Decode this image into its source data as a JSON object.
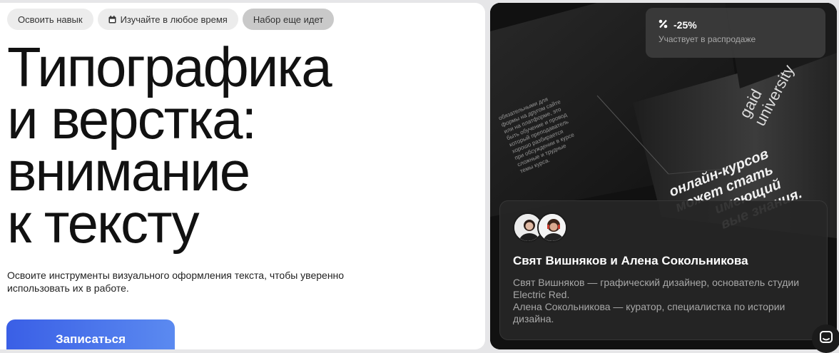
{
  "chips": [
    {
      "label": "Освоить навык"
    },
    {
      "label": "Изучайте в любое время",
      "icon": "calendar-icon"
    },
    {
      "label": "Набор еще идет"
    }
  ],
  "hero": {
    "title_lines": [
      "Типографика",
      "и верстка:",
      "внимание",
      "к тексту"
    ],
    "description_line1": "Освоите инструменты визуального оформления текста, чтобы уверенно",
    "description_line2": "использовать их в работе.",
    "cta_label": "Записаться"
  },
  "discount": {
    "icon": "percent-icon",
    "value": "-25%",
    "caption": "Участвует в распродаже"
  },
  "authors": {
    "names": "Свят Вишняков и Алена Сокольникова",
    "bio_line1": "Свят Вишняков — графический дизайнер, основатель студии",
    "bio_line2": "Electric Red.",
    "bio_line3": "Алена Сокольникова — куратор, специалистка по истории",
    "bio_line4": "дизайна."
  },
  "photo_text": {
    "line1": "онлайн-курсов",
    "line2": "может стать",
    "line3": "имеющий",
    "line4": "вые знания.",
    "brand1": "gaid",
    "brand2": "university"
  },
  "colors": {
    "accent": "#3a5fe6",
    "accent_light": "#5b8af0",
    "dark_panel": "#1a1a1a"
  },
  "chat": {
    "icon": "chat-icon"
  }
}
